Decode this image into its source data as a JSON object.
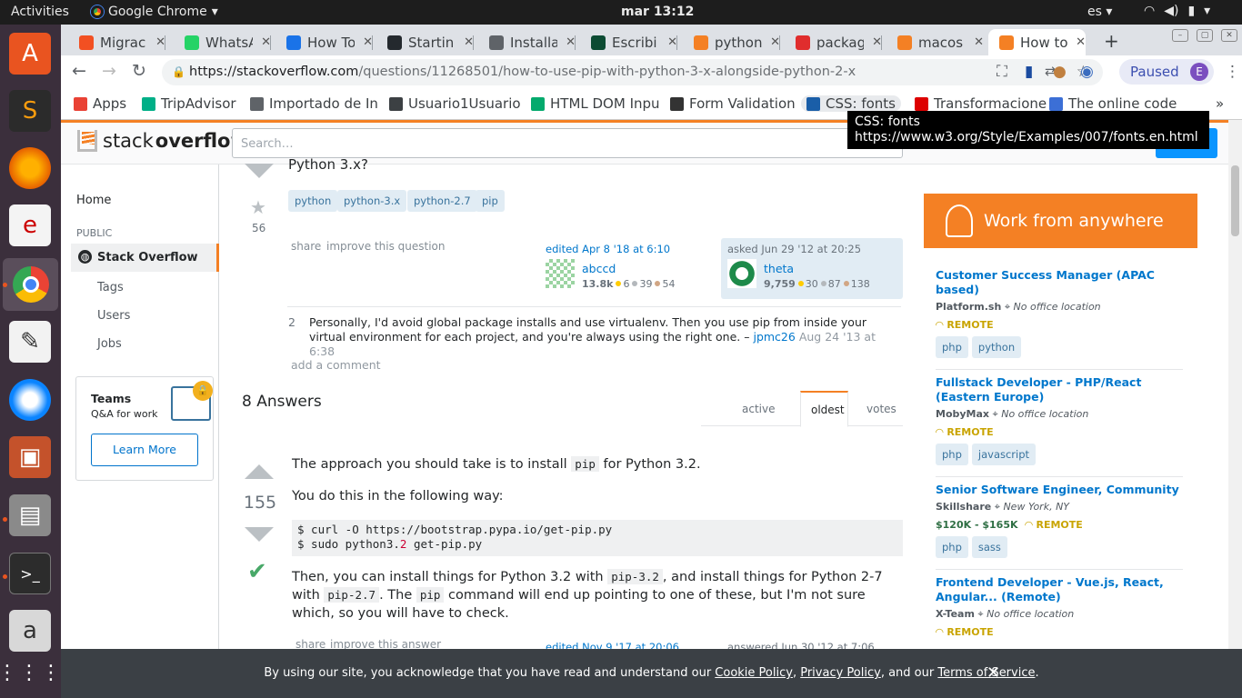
{
  "os": {
    "activities": "Activities",
    "app": "Google Chrome",
    "clock": "mar 13:12",
    "lang": "es"
  },
  "tabs": [
    {
      "label": "Migrac",
      "icon": "ms-icon",
      "color": "#f25022"
    },
    {
      "label": "WhatsA",
      "icon": "whatsapp-icon",
      "color": "#25d366"
    },
    {
      "label": "How To",
      "icon": "cloud-icon",
      "color": "#1a73e8"
    },
    {
      "label": "Startin",
      "icon": "github-icon",
      "color": "#24292e"
    },
    {
      "label": "Installa",
      "icon": "doc-icon",
      "color": "#5f6368"
    },
    {
      "label": "Escribi",
      "icon": "dj-icon",
      "color": "#0c4b33"
    },
    {
      "label": "python",
      "icon": "so-icon",
      "color": "#f48024"
    },
    {
      "label": "packag",
      "icon": "ask-icon",
      "color": "#e02d2d"
    },
    {
      "label": "macos",
      "icon": "so-icon",
      "color": "#f48024"
    },
    {
      "label": "How to",
      "icon": "so-icon",
      "color": "#f48024"
    }
  ],
  "url": {
    "host": "https://stackoverflow.com",
    "path": "/questions/11268501/how-to-use-pip-with-python-3-x-alongside-python-2-x"
  },
  "profile": {
    "paused": "Paused",
    "initial": "E"
  },
  "bookmarks": [
    {
      "label": "Apps",
      "icon": "apps-icon"
    },
    {
      "label": "TripAdvisor",
      "icon": "tripadvisor-icon"
    },
    {
      "label": "Importado de In",
      "icon": "folder-icon"
    },
    {
      "label": "Usuario1Usuario",
      "icon": "smiley-icon"
    },
    {
      "label": "HTML DOM Inpu",
      "icon": "w3-icon"
    },
    {
      "label": "Form Validation",
      "icon": "linux-icon"
    },
    {
      "label": "CSS: fonts",
      "icon": "w3c-icon"
    },
    {
      "label": "Transformacione",
      "icon": "info-icon"
    },
    {
      "label": "The online code",
      "icon": "bolt-icon"
    }
  ],
  "tooltip": {
    "title": "CSS: fonts",
    "url": "https://www.w3.org/Style/Examples/007/fonts.en.html"
  },
  "so": {
    "logo_a": "stack",
    "logo_b": "overflow",
    "search_placeholder": "Search…"
  },
  "leftnav": {
    "home": "Home",
    "public": "PUBLIC",
    "so": "Stack Overflow",
    "tags": "Tags",
    "users": "Users",
    "jobs": "Jobs"
  },
  "teams": {
    "title": "Teams",
    "sub": "Q&A for work",
    "button": "Learn More"
  },
  "question": {
    "title_tail": "Python 3.x?",
    "favorites": "56",
    "tags": [
      "python",
      "python-3.x",
      "python-2.7",
      "pip"
    ],
    "share": "share",
    "improve": "improve this question",
    "edited": {
      "when": "edited Apr 8 '18 at 6:10",
      "user": "abccd",
      "rep": "13.8k",
      "gold": "6",
      "silver": "39",
      "bronze": "54"
    },
    "asked": {
      "when": "asked Jun 29 '12 at 20:25",
      "user": "theta",
      "rep": "9,759",
      "gold": "30",
      "silver": "87",
      "bronze": "138"
    },
    "comment": {
      "score": "2",
      "text": "Personally, I'd avoid global package installs and use virtualenv. Then you use pip from inside your virtual environment for each project, and you're always using the right one. –",
      "user": "jpmc26",
      "date": "Aug 24 '13 at 6:38"
    },
    "add_comment": "add a comment"
  },
  "answers": {
    "count": "8 Answers",
    "tabs": [
      "active",
      "oldest",
      "votes"
    ],
    "score": "155",
    "p1a": "The approach you should take is to install ",
    "p1code": "pip",
    "p1b": " for Python 3.2.",
    "p2": "You do this in the following way:",
    "code1": "$ curl -O https://bootstrap.pypa.io/get-pip.py",
    "code2a": "$ sudo python3.",
    "code2b": "2",
    "code2c": " get-pip.py",
    "p3a": "Then, you can install things for Python 3.2 with ",
    "p3c1": "pip-3.2",
    "p3b": ", and install things for Python 2-7 with ",
    "p3c2": "pip-2.7",
    "p3c": ". The ",
    "p3c3": "pip",
    "p3d": " command will end up pointing to one of these, but I'm not sure which, so you will have to check.",
    "share": "share",
    "improve": "improve this answer",
    "edited": "edited Nov 9 '17 at 20:06",
    "answered": "answered Jun 30 '12 at 7:06"
  },
  "ad": "Work from anywhere",
  "jobs": [
    {
      "title": "Customer Success Manager (APAC based)",
      "company": "Platform.sh",
      "location": "No office location",
      "salary": "",
      "remote": "REMOTE",
      "tags": [
        "php",
        "python"
      ]
    },
    {
      "title": "Fullstack Developer - PHP/React (Eastern Europe)",
      "company": "MobyMax",
      "location": "No office location",
      "salary": "",
      "remote": "REMOTE",
      "tags": [
        "php",
        "javascript"
      ]
    },
    {
      "title": "Senior Software Engineer, Community",
      "company": "Skillshare",
      "location": "New York, NY",
      "salary": "$120K - $165K",
      "remote": "REMOTE",
      "tags": [
        "php",
        "sass"
      ]
    },
    {
      "title": "Frontend Developer - Vue.js, React, Angular... (Remote)",
      "company": "X-Team",
      "location": "No office location",
      "salary": "",
      "remote": "REMOTE",
      "tags": []
    }
  ],
  "cookie": {
    "a": "By using our site, you acknowledge that you have read and understand our ",
    "cp": "Cookie Policy",
    "b": ", ",
    "pp": "Privacy Policy",
    "c": ", and our ",
    "tos": "Terms of Service",
    "d": "."
  }
}
